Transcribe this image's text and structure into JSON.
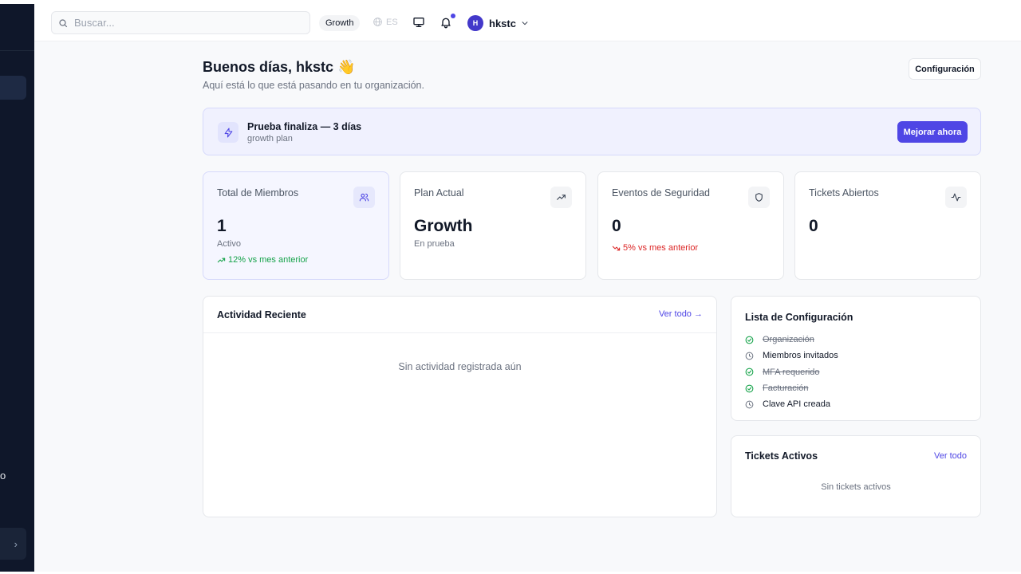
{
  "sidebar": {
    "fragment_text": "o",
    "collapse_glyph": "›"
  },
  "header": {
    "search_placeholder": "Buscar...",
    "plan_chip": "Growth",
    "language": "ES",
    "user": {
      "initial": "H",
      "name": "hkstc"
    },
    "icons": [
      "search-icon",
      "globe-icon",
      "monitor-icon",
      "bell-icon",
      "chevron-down-icon"
    ]
  },
  "greeting": {
    "title": "Buenos días, hkstc 👋",
    "subtitle": "Aquí está lo que está pasando en tu organización.",
    "settings_button": "Configuración"
  },
  "trial_banner": {
    "title": "Prueba finaliza — 3 días",
    "subtitle": "growth plan",
    "button": "Mejorar ahora"
  },
  "stats": [
    {
      "label": "Total de Miembros",
      "value": "1",
      "sub": "Activo",
      "trend": "12% vs mes anterior",
      "trend_dir": "up",
      "icon": "users-icon"
    },
    {
      "label": "Plan Actual",
      "value": "Growth",
      "sub": "En prueba",
      "icon": "trending-up-icon"
    },
    {
      "label": "Eventos de Seguridad",
      "value": "0",
      "trend": "5% vs mes anterior",
      "trend_dir": "down",
      "icon": "shield-icon"
    },
    {
      "label": "Tickets Abiertos",
      "value": "0",
      "icon": "activity-icon"
    }
  ],
  "activity": {
    "title": "Actividad Reciente",
    "view_all": "Ver todo →",
    "empty": "Sin actividad registrada aún"
  },
  "checklist": {
    "title": "Lista de Configuración",
    "items": [
      {
        "label": "Organización",
        "done": true
      },
      {
        "label": "Miembros invitados",
        "done": false
      },
      {
        "label": "MFA requerido",
        "done": true
      },
      {
        "label": "Facturación",
        "done": true
      },
      {
        "label": "Clave API creada",
        "done": false
      }
    ]
  },
  "tickets": {
    "title": "Tickets Activos",
    "view_all": "Ver todo",
    "empty": "Sin tickets activos"
  },
  "colors": {
    "accent": "#4f46e5",
    "sidebar": "#0f172a",
    "success": "#16a34a",
    "danger": "#dc2626"
  }
}
